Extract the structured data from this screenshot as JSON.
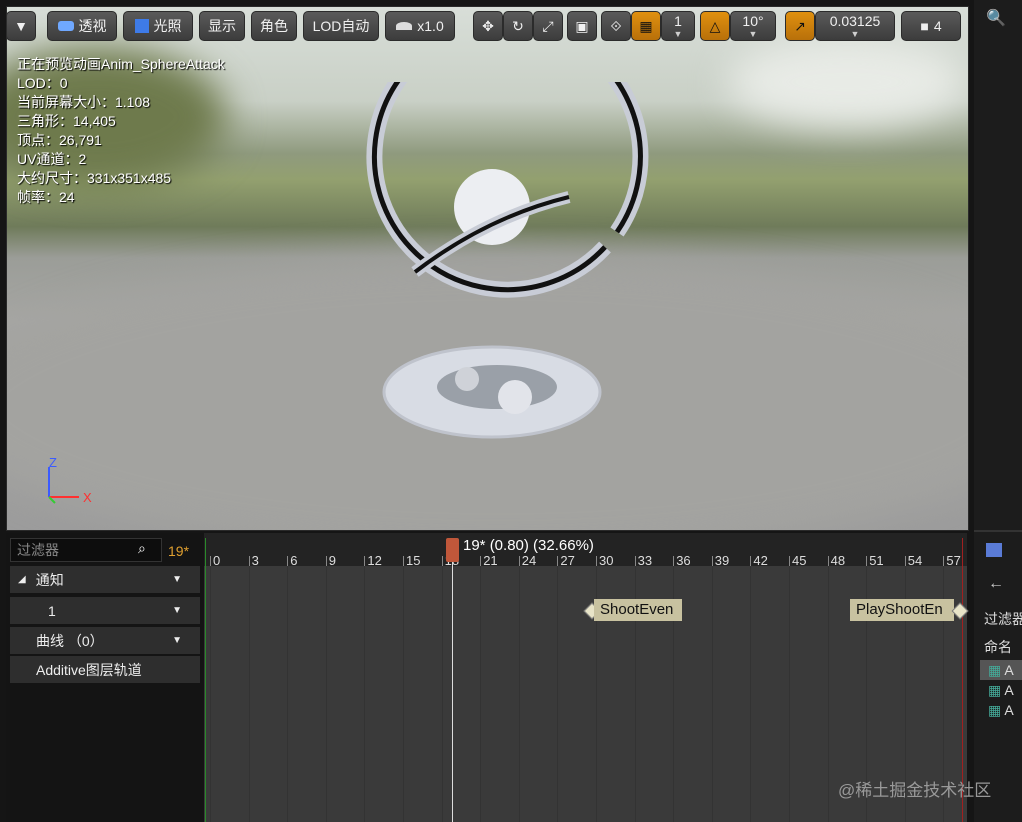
{
  "toolbar": {
    "menu_arrow": "▼",
    "perspective": "透视",
    "lighting": "光照",
    "show": "显示",
    "character": "角色",
    "lod": "LOD自动",
    "speed": "x1.0",
    "grid_value": "1",
    "angle_value": "10°",
    "scale_value": "0.03125",
    "camera_speed": "4"
  },
  "stats": [
    "正在预览动画Anim_SphereAttack",
    "LOD：0",
    "当前屏幕大小：1.108",
    "三角形：14,405",
    "顶点：26,791",
    "UV通道：2",
    "大约尺寸：331x351x485",
    "帧率：24"
  ],
  "axis": {
    "z": "Z",
    "x": "X"
  },
  "timeline": {
    "filter_placeholder": "过滤器",
    "current_frame": "19*",
    "playhead_label": "19* (0.80) (32.66%)",
    "ticks": [
      "0",
      "3",
      "6",
      "9",
      "12",
      "15",
      "18",
      "21",
      "24",
      "27",
      "30",
      "33",
      "36",
      "39",
      "42",
      "45",
      "48",
      "51",
      "54",
      "57"
    ],
    "tracks": [
      {
        "label": "通知",
        "icon": "triangle-down"
      },
      {
        "label": "1"
      },
      {
        "label": "曲线 （0）"
      },
      {
        "label": "Additive图层轨道"
      }
    ],
    "notifies": [
      "ShootEven",
      "PlayShootEn"
    ]
  },
  "right_panel": {
    "filter_label": "过滤器",
    "name_label": "命名",
    "items": [
      "A",
      "A",
      "A"
    ]
  },
  "watermark": "@稀土掘金技术社区"
}
